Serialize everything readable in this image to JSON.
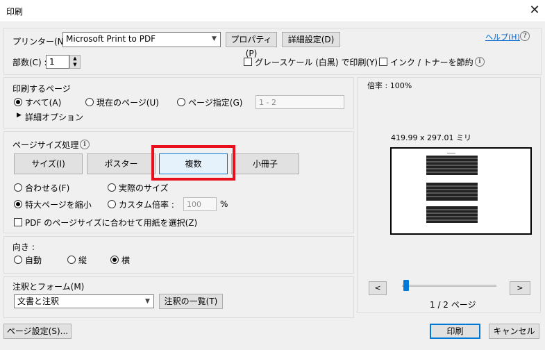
{
  "window": {
    "title": "印刷"
  },
  "printer": {
    "label": "プリンター(N) :",
    "selected": "Microsoft Print to PDF",
    "properties_button": "プロパティ(P)",
    "advanced_button": "詳細設定(D)",
    "help_link": "ヘルプ(H)"
  },
  "copies": {
    "label": "部数(C) :",
    "value": "1"
  },
  "options": {
    "grayscale": "グレースケール (白黒) で印刷(Y)",
    "save_ink": "インク / トナーを節約"
  },
  "pages": {
    "heading": "印刷するページ",
    "all": "すべて(A)",
    "current": "現在のページ(U)",
    "range": "ページ指定(G)",
    "range_value": "1 - 2",
    "more_options": "詳細オプション"
  },
  "sizing": {
    "heading": "ページサイズ処理",
    "modes": [
      "サイズ(I)",
      "ポスター",
      "複数",
      "小冊子"
    ],
    "selected_mode": "複数",
    "fit": "合わせる(F)",
    "actual": "実際のサイズ",
    "shrink": "特大ページを縮小",
    "custom": "カスタム倍率 :",
    "custom_value": "100",
    "percent": "%",
    "pdf_paper": "PDF のページサイズに合わせて用紙を選択(Z)"
  },
  "orientation": {
    "heading": "向き :",
    "auto": "自動",
    "portrait": "縦",
    "landscape": "横"
  },
  "comments": {
    "heading": "注釈とフォーム(M)",
    "selected": "文書と注釈",
    "summary_button": "注釈の一覧(T)"
  },
  "preview": {
    "scale": "倍率 : 100%",
    "dimensions": "419.99 x 297.01 ミリ",
    "prev": "<",
    "next": ">",
    "page_indicator": "1 / 2 ページ",
    "slider_fraction": 0.02
  },
  "footer": {
    "page_setup": "ページ設定(S)...",
    "print": "印刷",
    "cancel": "キャンセル"
  },
  "colors": {
    "highlight": "#e8101c",
    "selected_border": "#0078d7",
    "link": "#0066cc"
  },
  "icons": {
    "close": "close-icon",
    "info": "info-icon",
    "help": "help-icon",
    "dropdown": "chevron-down-icon",
    "expand": "triangle-right-icon"
  }
}
